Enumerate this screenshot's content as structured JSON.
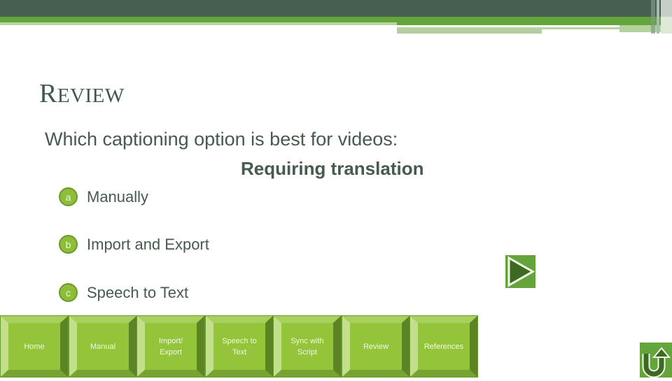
{
  "slide": {
    "title_initial": "R",
    "title_rest": "EVIEW",
    "question": "Which captioning option is best for videos:",
    "sub_question": "Requiring translation",
    "options": [
      {
        "letter": "a",
        "label": "Manually"
      },
      {
        "letter": "b",
        "label": "Import and Export"
      },
      {
        "letter": "c",
        "label": "Speech to Text"
      }
    ]
  },
  "nav": {
    "buttons": [
      {
        "line1": "Home",
        "line2": ""
      },
      {
        "line1": "Manual",
        "line2": ""
      },
      {
        "line1": "Import/",
        "line2": "Export"
      },
      {
        "line1": "Speech to",
        "line2": "Text"
      },
      {
        "line1": "Sync with",
        "line2": "Script"
      },
      {
        "line1": "Review",
        "line2": ""
      },
      {
        "line1": "References",
        "line2": ""
      }
    ],
    "next_icon": "play-triangle",
    "return_icon": "u-turn-arrow"
  },
  "colors": {
    "header_dark": "#465f50",
    "header_green": "#63a53a",
    "text": "#465a4e",
    "bullet": "#8dbe3a",
    "button_face": "#93c43a"
  }
}
